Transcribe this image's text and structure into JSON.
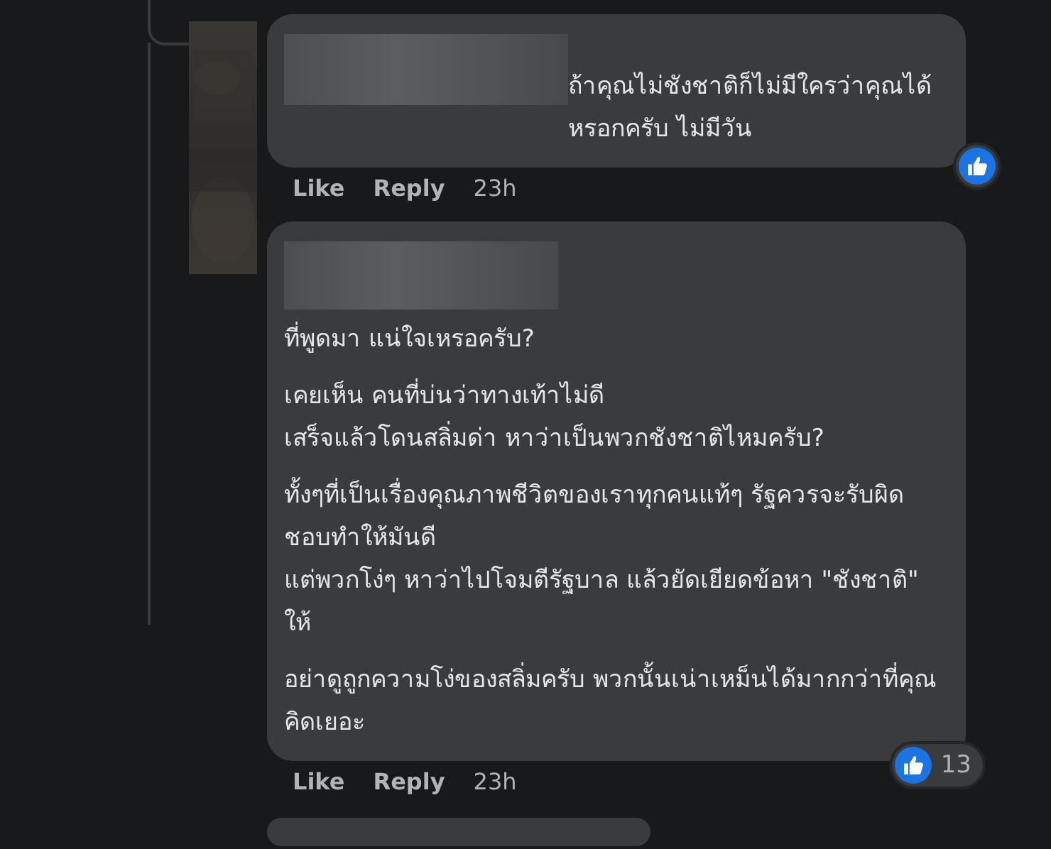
{
  "comments": [
    {
      "kind": "inline",
      "paragraphs": [
        [
          "ถ้าคุณไม่ชังชาติก็ไม่มีใครว่าคุณได้หรอกครับ ไม่มีวัน"
        ]
      ],
      "actions": [
        "Like",
        "Reply"
      ],
      "time": "23h",
      "reaction": {
        "kind": "like"
      }
    },
    {
      "kind": "block",
      "paragraphs": [
        [
          "ที่พูดมา แน่ใจเหรอครับ?"
        ],
        [
          "เคยเห็น คนที่บ่นว่าทางเท้าไม่ดี",
          "เสร็จแล้วโดนสลิ่มด่า หาว่าเป็นพวกชังชาติไหมครับ?"
        ],
        [
          "ทั้งๆที่เป็นเรื่องคุณภาพชีวิตของเราทุกคนแท้ๆ รัฐควรจะรับผิดชอบทำให้มันดี",
          "แต่พวกโง่ๆ หาว่าไปโจมตีรัฐบาล แล้วยัดเยียดข้อหา \"ชังชาติ\" ให้"
        ],
        [
          "อย่าดูถูกความโง่ของสลิ่มครับ พวกนั้นเน่าเหม็นได้มากกว่าที่คุณคิดเยอะ"
        ]
      ],
      "actions": [
        "Like",
        "Reply"
      ],
      "time": "23h",
      "reaction": {
        "kind": "like",
        "count": "13"
      }
    }
  ]
}
